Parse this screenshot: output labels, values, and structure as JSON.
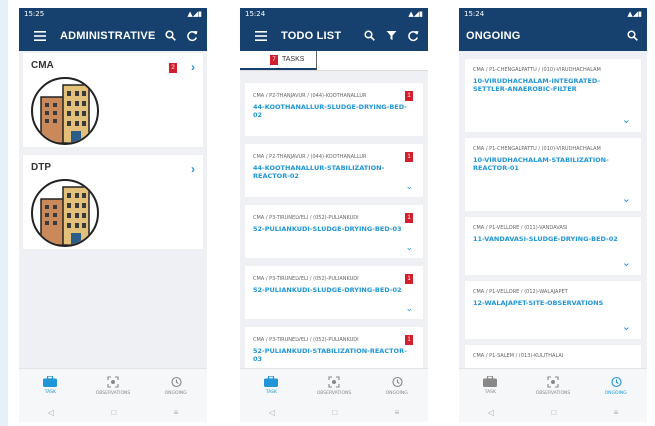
{
  "colors": {
    "primary": "#16406d",
    "accent": "#2196d6",
    "badge": "#d21f2b"
  },
  "nav": {
    "task": "TASK",
    "observations": "OBSERVATIONS",
    "ongoing": "ONGOING"
  },
  "screens": [
    {
      "status_time": "15:25",
      "title": "ADMINISTRATIVE...",
      "categories": [
        {
          "name": "CMA",
          "badge": "2"
        },
        {
          "name": "DTP",
          "badge": ""
        }
      ]
    },
    {
      "status_time": "15:24",
      "title": "TODO LIST",
      "tab": {
        "label": "TASKS",
        "badge": "7"
      },
      "tasks": [
        {
          "path": "CMA / P2-THANJAVUR / (044)-KOOTHANALLUR",
          "name": "44-KOOTHANALLUR-SLUDGE-DRYING-BED-02",
          "badge": "1"
        },
        {
          "path": "CMA / P2-THANJAVUR / (044)-KOOTHANALLUR",
          "name": "44-KOOTHANALLUR-STABILIZATION-REACTOR-02",
          "badge": "1"
        },
        {
          "path": "CMA / P3-TIRUNELVELI / (052)-PULIANKUDI",
          "name": "52-PULIANKUDI-SLUDGE-DRYING-BED-03",
          "badge": "1"
        },
        {
          "path": "CMA / P3-TIRUNELVELI / (052)-PULIANKUDI",
          "name": "52-PULIANKUDI-SLUDGE-DRYING-BED-02",
          "badge": "1"
        },
        {
          "path": "CMA / P3-TIRUNELVELI / (052)-PULIANKUDI",
          "name": "52-PULIANKUDI-STABILIZATION-REACTOR-03",
          "badge": "1"
        }
      ]
    },
    {
      "status_time": "15:24",
      "title": "ONGOING",
      "items": [
        {
          "path": "CMA / P1-CHENGALPATTU / (010)-VIRUDHACHALAM",
          "name": "10-VIRUDHACHALAM-INTEGRATED-SETTLER-ANAEROBIC-FILTER"
        },
        {
          "path": "CMA / P1-CHENGALPATTU / (010)-VIRUDHACHALAM",
          "name": "10-VIRUDHACHALAM-STABILIZATION-REACTOR-01"
        },
        {
          "path": "CMA / P1-VELLORE / (011)-VANDAVASI",
          "name": "11-VANDAVASI-SLUDGE-DRYING-BED-02"
        },
        {
          "path": "CMA / P1-VELLORE / (012)-WALAJAPET",
          "name": "12-WALAJAPET-SITE-OBSERVATIONS"
        },
        {
          "path": "CMA / P1-SALEM / (013)-KULITHALAI",
          "name": ""
        }
      ]
    }
  ]
}
